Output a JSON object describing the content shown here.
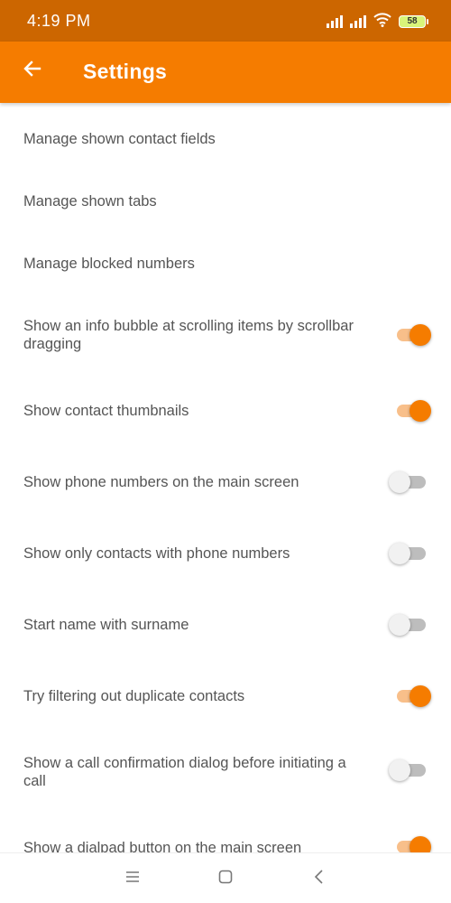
{
  "status_bar": {
    "time": "4:19 PM",
    "battery_level": "58",
    "icons": [
      "signal-icon",
      "signal-icon",
      "wifi-icon",
      "battery-icon"
    ]
  },
  "app_bar": {
    "back_icon": "arrow-back-icon",
    "title": "Settings"
  },
  "settings": [
    {
      "label": "Manage shown contact fields",
      "has_toggle": false
    },
    {
      "label": "Manage shown tabs",
      "has_toggle": false
    },
    {
      "label": "Manage blocked numbers",
      "has_toggle": false
    },
    {
      "label": "Show an info bubble at scrolling items by scrollbar dragging",
      "has_toggle": true,
      "enabled": true
    },
    {
      "label": "Show contact thumbnails",
      "has_toggle": true,
      "enabled": true
    },
    {
      "label": "Show phone numbers on the main screen",
      "has_toggle": true,
      "enabled": false
    },
    {
      "label": "Show only contacts with phone numbers",
      "has_toggle": true,
      "enabled": false
    },
    {
      "label": "Start name with surname",
      "has_toggle": true,
      "enabled": false
    },
    {
      "label": "Try filtering out duplicate contacts",
      "has_toggle": true,
      "enabled": true
    },
    {
      "label": "Show a call confirmation dialog before initiating a call",
      "has_toggle": true,
      "enabled": false
    },
    {
      "label": "Show a dialpad button on the main screen",
      "has_toggle": true,
      "enabled": true
    }
  ],
  "nav_bar": {
    "icons": [
      "menu-icon",
      "home-icon",
      "back-icon"
    ]
  },
  "colors": {
    "status_bar": "#cc6600",
    "app_bar": "#f57c00",
    "toggle_on": "#f57c00",
    "toggle_on_track": "#f8bf8a",
    "toggle_off_track": "#bdbdbd",
    "text": "#555555"
  }
}
